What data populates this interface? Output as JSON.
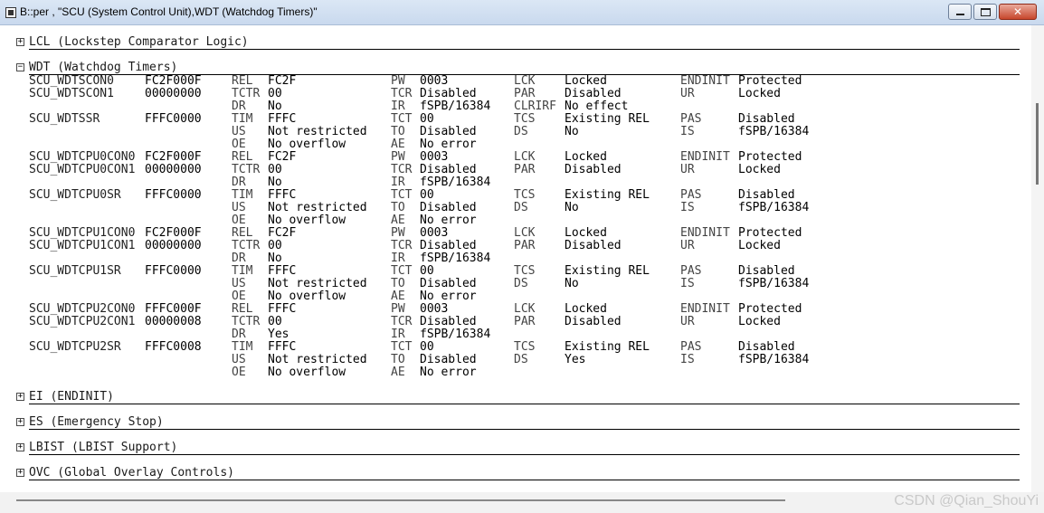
{
  "window": {
    "title": "B::per , \"SCU (System Control Unit),WDT (Watchdog Timers)\""
  },
  "sections": {
    "lcl": {
      "toggle": "+",
      "label": "LCL (Lockstep Comparator Logic)"
    },
    "wdt": {
      "toggle": "−",
      "label": "WDT (Watchdog Timers)"
    },
    "ei": {
      "toggle": "+",
      "label": "EI (ENDINIT)"
    },
    "es": {
      "toggle": "+",
      "label": "ES (Emergency Stop)"
    },
    "lbist": {
      "toggle": "+",
      "label": "LBIST (LBIST Support)"
    },
    "ovc": {
      "toggle": "+",
      "label": "OVC (Global Overlay Controls)"
    }
  },
  "rows": [
    [
      "SCU_WDTSCON0",
      "FC2F000F",
      "REL",
      "FC2F",
      "PW",
      "0003",
      "LCK",
      "Locked",
      "ENDINIT",
      "Protected"
    ],
    [
      "SCU_WDTSCON1",
      "00000000",
      "TCTR",
      "00",
      "TCR",
      "Disabled",
      "PAR",
      "Disabled",
      "UR",
      "Locked"
    ],
    [
      "",
      "",
      "DR",
      "No",
      "IR",
      "fSPB/16384",
      "CLRIRF",
      "No effect",
      "",
      ""
    ],
    [
      "SCU_WDTSSR",
      "FFFC0000",
      "TIM",
      "FFFC",
      "TCT",
      "00",
      "TCS",
      "Existing REL",
      "PAS",
      "Disabled"
    ],
    [
      "",
      "",
      "US",
      "Not restricted",
      "TO",
      "Disabled",
      "DS",
      "No",
      "IS",
      "fSPB/16384"
    ],
    [
      "",
      "",
      "OE",
      "No overflow",
      "AE",
      "No error",
      "",
      "",
      "",
      ""
    ],
    [
      "SCU_WDTCPU0CON0",
      "FC2F000F",
      "REL",
      "FC2F",
      "PW",
      "0003",
      "LCK",
      "Locked",
      "ENDINIT",
      "Protected"
    ],
    [
      "SCU_WDTCPU0CON1",
      "00000000",
      "TCTR",
      "00",
      "TCR",
      "Disabled",
      "PAR",
      "Disabled",
      "UR",
      "Locked"
    ],
    [
      "",
      "",
      "DR",
      "No",
      "IR",
      "fSPB/16384",
      "",
      "",
      "",
      ""
    ],
    [
      "SCU_WDTCPU0SR",
      "FFFC0000",
      "TIM",
      "FFFC",
      "TCT",
      "00",
      "TCS",
      "Existing REL",
      "PAS",
      "Disabled"
    ],
    [
      "",
      "",
      "US",
      "Not restricted",
      "TO",
      "Disabled",
      "DS",
      "No",
      "IS",
      "fSPB/16384"
    ],
    [
      "",
      "",
      "OE",
      "No overflow",
      "AE",
      "No error",
      "",
      "",
      "",
      ""
    ],
    [
      "SCU_WDTCPU1CON0",
      "FC2F000F",
      "REL",
      "FC2F",
      "PW",
      "0003",
      "LCK",
      "Locked",
      "ENDINIT",
      "Protected"
    ],
    [
      "SCU_WDTCPU1CON1",
      "00000000",
      "TCTR",
      "00",
      "TCR",
      "Disabled",
      "PAR",
      "Disabled",
      "UR",
      "Locked"
    ],
    [
      "",
      "",
      "DR",
      "No",
      "IR",
      "fSPB/16384",
      "",
      "",
      "",
      ""
    ],
    [
      "SCU_WDTCPU1SR",
      "FFFC0000",
      "TIM",
      "FFFC",
      "TCT",
      "00",
      "TCS",
      "Existing REL",
      "PAS",
      "Disabled"
    ],
    [
      "",
      "",
      "US",
      "Not restricted",
      "TO",
      "Disabled",
      "DS",
      "No",
      "IS",
      "fSPB/16384"
    ],
    [
      "",
      "",
      "OE",
      "No overflow",
      "AE",
      "No error",
      "",
      "",
      "",
      ""
    ],
    [
      "SCU_WDTCPU2CON0",
      "FFFC000F",
      "REL",
      "FFFC",
      "PW",
      "0003",
      "LCK",
      "Locked",
      "ENDINIT",
      "Protected"
    ],
    [
      "SCU_WDTCPU2CON1",
      "00000008",
      "TCTR",
      "00",
      "TCR",
      "Disabled",
      "PAR",
      "Disabled",
      "UR",
      "Locked"
    ],
    [
      "",
      "",
      "DR",
      "Yes",
      "IR",
      "fSPB/16384",
      "",
      "",
      "",
      ""
    ],
    [
      "SCU_WDTCPU2SR",
      "FFFC0008",
      "TIM",
      "FFFC",
      "TCT",
      "00",
      "TCS",
      "Existing REL",
      "PAS",
      "Disabled"
    ],
    [
      "",
      "",
      "US",
      "Not restricted",
      "TO",
      "Disabled",
      "DS",
      "Yes",
      "IS",
      "fSPB/16384"
    ],
    [
      "",
      "",
      "OE",
      "No overflow",
      "AE",
      "No error",
      "",
      "",
      "",
      ""
    ]
  ],
  "watermark": "CSDN @Qian_ShouYi"
}
